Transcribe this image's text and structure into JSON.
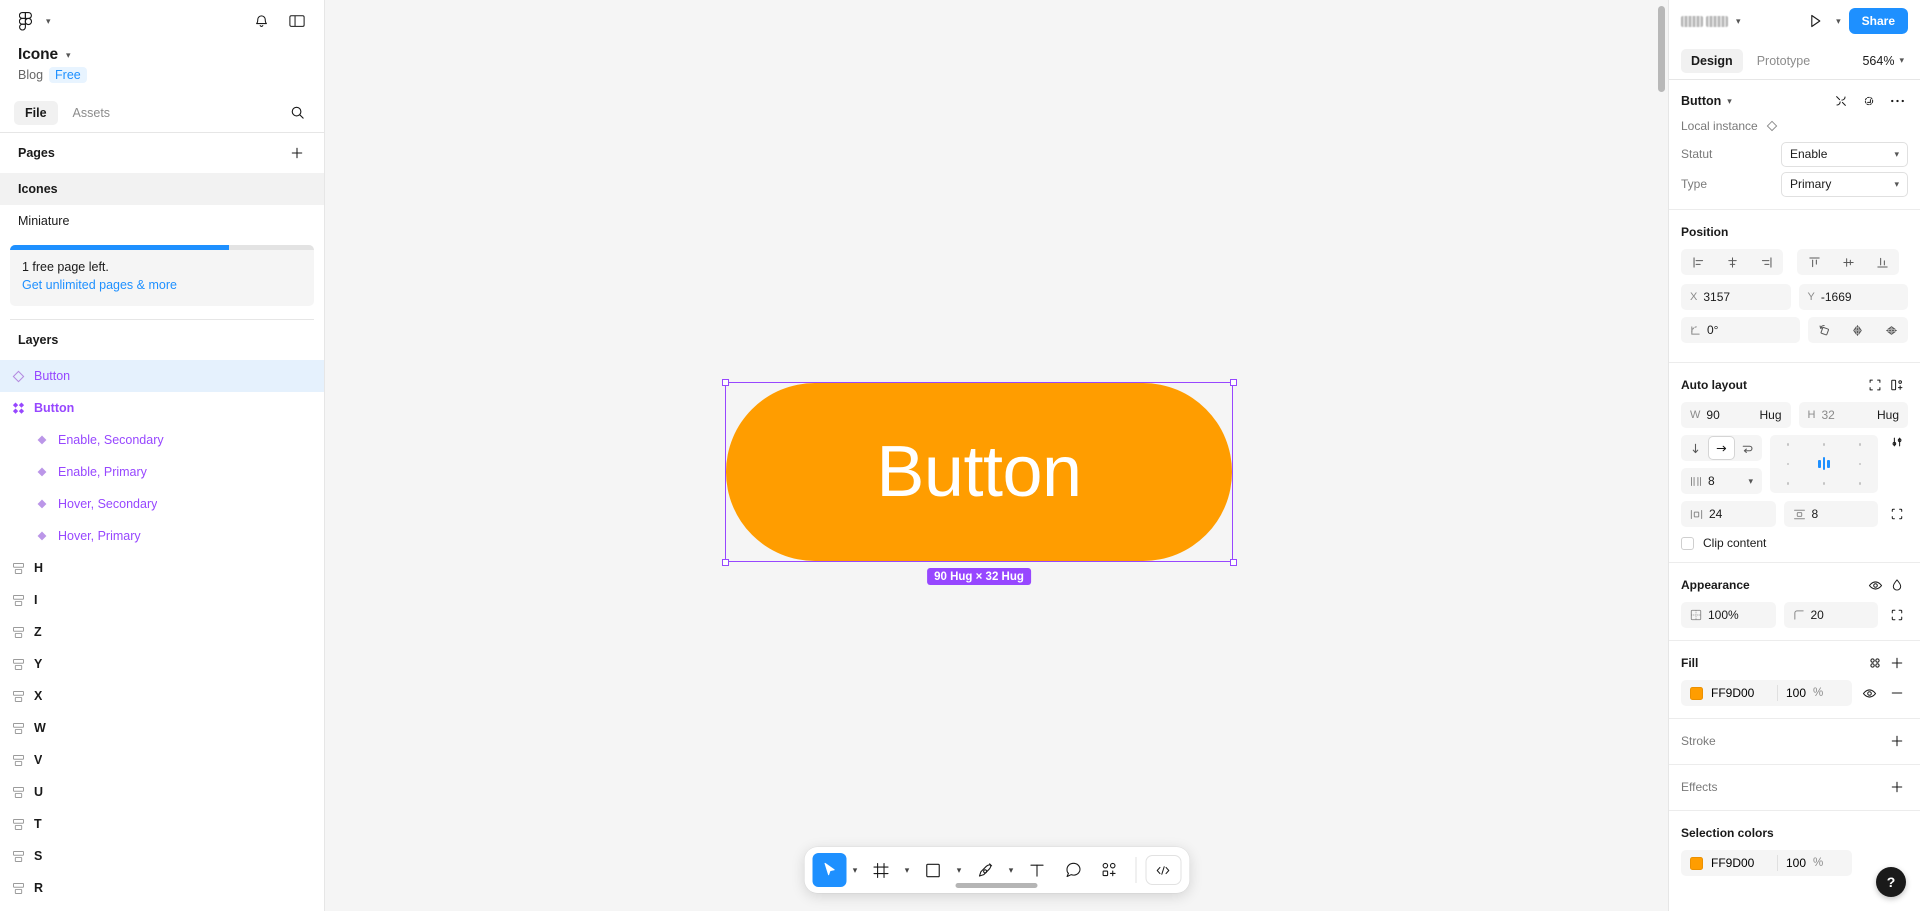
{
  "app": {
    "name": "Figma",
    "logo_icon": "figma-logo-icon"
  },
  "left_panel": {
    "top_icons": {
      "notifications": "bell-icon",
      "panel_toggle": "panel-layout-icon",
      "menu_caret": "chevron-down-icon"
    },
    "file": {
      "title": "Icone",
      "team": "Blog",
      "plan_badge": "Free"
    },
    "tabs": [
      {
        "id": "file",
        "label": "File",
        "active": true
      },
      {
        "id": "assets",
        "label": "Assets",
        "active": false
      }
    ],
    "search_icon": "search-icon",
    "pages": {
      "title": "Pages",
      "add_icon": "plus-icon",
      "items": [
        {
          "label": "Icones",
          "selected": true
        },
        {
          "label": "Miniature",
          "selected": false
        }
      ]
    },
    "upsell": {
      "progress_percent": 72,
      "line1": "1 free page left.",
      "link": "Get unlimited pages & more"
    },
    "layers": {
      "title": "Layers",
      "items": [
        {
          "label": "Button",
          "icon": "component-instance-icon",
          "level": 0,
          "selected": true,
          "style": "purple"
        },
        {
          "label": "Button",
          "icon": "component-set-icon",
          "level": 0,
          "selected": false,
          "style": "purple-bold"
        },
        {
          "label": "Enable, Secondary",
          "icon": "component-icon",
          "level": 1,
          "selected": false,
          "style": "purple"
        },
        {
          "label": "Enable, Primary",
          "icon": "component-icon",
          "level": 1,
          "selected": false,
          "style": "purple"
        },
        {
          "label": "Hover, Secondary",
          "icon": "component-icon",
          "level": 1,
          "selected": false,
          "style": "purple"
        },
        {
          "label": "Hover, Primary",
          "icon": "component-icon",
          "level": 1,
          "selected": false,
          "style": "purple"
        },
        {
          "label": "H",
          "icon": "frame-icon",
          "level": 0,
          "selected": false,
          "style": "dark"
        },
        {
          "label": "I",
          "icon": "frame-icon",
          "level": 0,
          "selected": false,
          "style": "dark"
        },
        {
          "label": "Z",
          "icon": "frame-icon",
          "level": 0,
          "selected": false,
          "style": "dark"
        },
        {
          "label": "Y",
          "icon": "frame-icon",
          "level": 0,
          "selected": false,
          "style": "dark"
        },
        {
          "label": "X",
          "icon": "frame-icon",
          "level": 0,
          "selected": false,
          "style": "dark"
        },
        {
          "label": "W",
          "icon": "frame-icon",
          "level": 0,
          "selected": false,
          "style": "dark"
        },
        {
          "label": "V",
          "icon": "frame-icon",
          "level": 0,
          "selected": false,
          "style": "dark"
        },
        {
          "label": "U",
          "icon": "frame-icon",
          "level": 0,
          "selected": false,
          "style": "dark"
        },
        {
          "label": "T",
          "icon": "frame-icon",
          "level": 0,
          "selected": false,
          "style": "dark"
        },
        {
          "label": "S",
          "icon": "frame-icon",
          "level": 0,
          "selected": false,
          "style": "dark"
        },
        {
          "label": "R",
          "icon": "frame-icon",
          "level": 0,
          "selected": false,
          "style": "dark"
        }
      ]
    }
  },
  "canvas": {
    "background": "#F5F5F5",
    "selection": {
      "label": "Button",
      "fill": "#FF9D00",
      "text_color": "#FFFFFF",
      "size_badge": "90 Hug × 32 Hug",
      "selection_color": "#9747FF"
    },
    "toolbar": {
      "tools": [
        {
          "id": "move",
          "icon": "cursor-arrow-icon",
          "active": true,
          "has_caret": true
        },
        {
          "id": "frame",
          "icon": "frame-grid-icon",
          "active": false,
          "has_caret": true
        },
        {
          "id": "shape",
          "icon": "square-icon",
          "active": false,
          "has_caret": true
        },
        {
          "id": "pen",
          "icon": "pen-icon",
          "active": false,
          "has_caret": true
        },
        {
          "id": "text",
          "icon": "text-t-icon",
          "active": false,
          "has_caret": false
        },
        {
          "id": "comment",
          "icon": "comment-bubble-icon",
          "active": false,
          "has_caret": false
        },
        {
          "id": "actions",
          "icon": "plugins-actions-icon",
          "active": false,
          "has_caret": false
        }
      ],
      "dev_mode": {
        "id": "dev-mode",
        "icon": "code-brackets-icon"
      }
    }
  },
  "right_panel": {
    "share_label": "Share",
    "present_icon": "play-icon",
    "present_caret": "chevron-down-icon",
    "collaborator_caret": "chevron-down-icon",
    "tabs": [
      {
        "id": "design",
        "label": "Design",
        "active": true
      },
      {
        "id": "prototype",
        "label": "Prototype",
        "active": false
      }
    ],
    "zoom": "564%",
    "component": {
      "name": "Button",
      "edit_icon": "edit-component-icon",
      "swap_icon": "swap-instance-icon",
      "more_icon": "more-options-icon",
      "local_instance_label": "Local instance",
      "local_instance_icon": "component-diamond-icon",
      "properties": [
        {
          "label": "Statut",
          "value": "Enable"
        },
        {
          "label": "Type",
          "value": "Primary"
        }
      ]
    },
    "position": {
      "title": "Position",
      "align_horizontal": [
        "align-left-icon",
        "align-horizontal-center-icon",
        "align-right-icon"
      ],
      "align_vertical": [
        "align-top-icon",
        "align-vertical-center-icon",
        "align-bottom-icon"
      ],
      "x_label": "X",
      "x_value": "3157",
      "y_label": "Y",
      "y_value": "-1669",
      "rotation_icon": "rotation-icon",
      "rotation_value": "0°",
      "transform_icons": [
        "flip-rotate-icon",
        "flip-horizontal-icon",
        "flip-vertical-icon"
      ]
    },
    "auto_layout": {
      "title": "Auto layout",
      "collapse_icon": "remove-autolayout-icon",
      "add_icon": "add-autolayout-icon",
      "w_label": "W",
      "w_value": "90",
      "w_mode": "Hug",
      "h_label": "H",
      "h_value": "32",
      "h_mode": "Hug",
      "directions": [
        {
          "id": "vertical",
          "icon": "arrow-down-icon",
          "selected": false
        },
        {
          "id": "horizontal",
          "icon": "arrow-right-icon",
          "selected": true
        },
        {
          "id": "wrap",
          "icon": "wrap-icon",
          "selected": false
        }
      ],
      "gap_icon": "gap-spacing-icon",
      "gap_value": "8",
      "gap_caret": "chevron-down-icon",
      "advanced_icon": "advanced-layout-icon",
      "padding_h_icon": "horizontal-padding-icon",
      "padding_h_value": "24",
      "padding_v_icon": "vertical-padding-icon",
      "padding_v_value": "8",
      "padding_more_icon": "individual-padding-icon",
      "clip_content_label": "Clip content",
      "clip_content_checked": false
    },
    "appearance": {
      "title": "Appearance",
      "visibility_icon": "eye-icon",
      "blend_icon": "blend-mode-icon",
      "opacity_icon": "opacity-icon",
      "opacity_value": "100%",
      "corner_icon": "corner-radius-icon",
      "corner_value": "20",
      "corner_more_icon": "individual-corners-icon"
    },
    "fill": {
      "title": "Fill",
      "styles_icon": "color-styles-icon",
      "add_icon": "plus-icon",
      "items": [
        {
          "hex": "FF9D00",
          "color": "#FF9D00",
          "opacity": "100",
          "unit": "%",
          "visibility_icon": "eye-icon",
          "remove_icon": "minus-icon"
        }
      ]
    },
    "stroke": {
      "title": "Stroke",
      "add_icon": "plus-icon"
    },
    "effects": {
      "title": "Effects",
      "add_icon": "plus-icon"
    },
    "selection_colors": {
      "title": "Selection colors",
      "items": [
        {
          "hex": "FF9D00",
          "color": "#FF9D00",
          "opacity": "100",
          "unit": "%"
        }
      ]
    },
    "help_fab": {
      "icon": "help-question-icon",
      "label": "?"
    }
  }
}
